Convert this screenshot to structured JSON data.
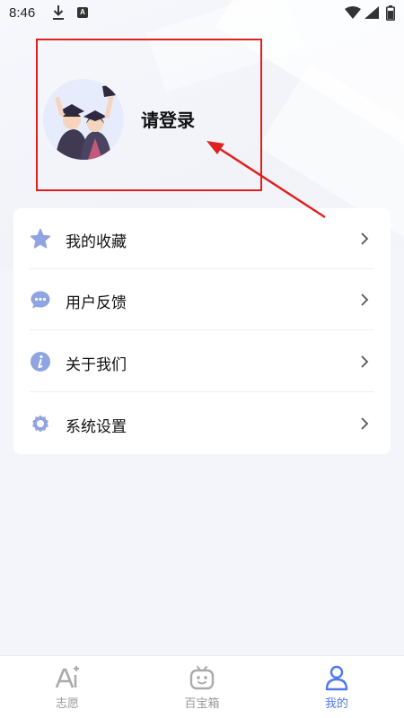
{
  "status_bar": {
    "time": "8:46"
  },
  "profile": {
    "login_label": "请登录"
  },
  "menu": {
    "items": [
      {
        "label": "我的收藏",
        "icon": "star-icon"
      },
      {
        "label": "用户反馈",
        "icon": "chat-bubble-icon"
      },
      {
        "label": "关于我们",
        "icon": "info-icon"
      },
      {
        "label": "系统设置",
        "icon": "gear-icon"
      }
    ]
  },
  "tabs": [
    {
      "label": "志愿",
      "icon": "ai-icon",
      "active": false
    },
    {
      "label": "百宝箱",
      "icon": "robot-box-icon",
      "active": false
    },
    {
      "label": "我的",
      "icon": "person-icon",
      "active": true
    }
  ],
  "colors": {
    "accent": "#4f78ee",
    "icon": "#8fa4e0",
    "highlight": "#e02020"
  }
}
